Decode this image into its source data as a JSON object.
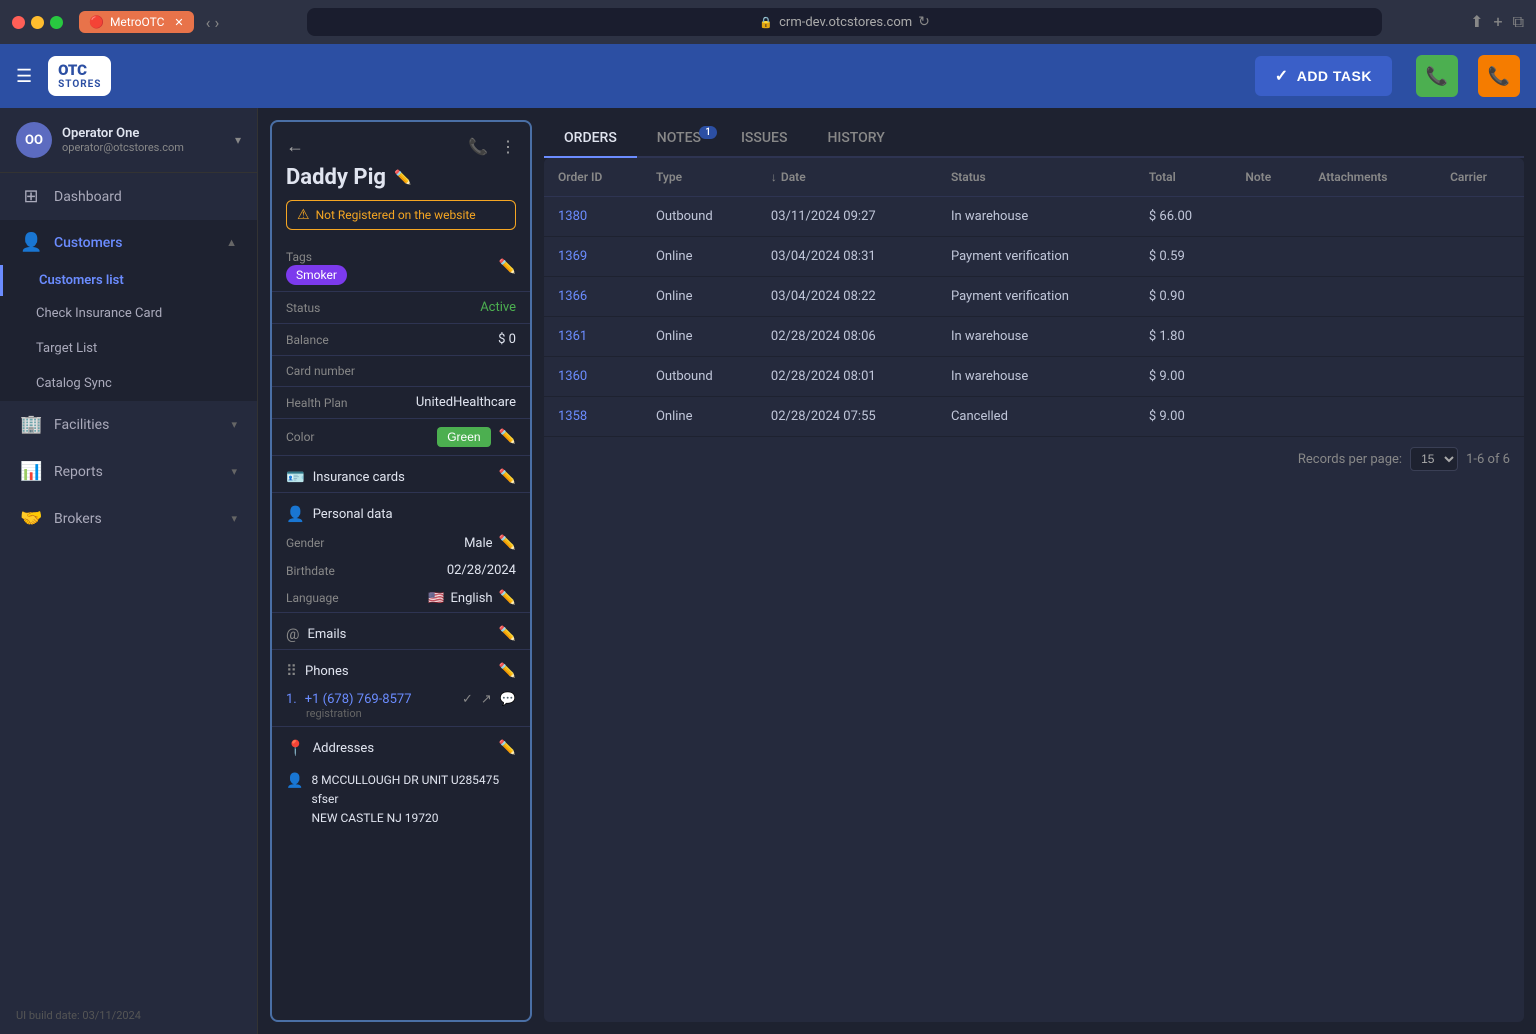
{
  "titlebar": {
    "tab_label": "MetroOTC",
    "url": "crm-dev.otcstores.com"
  },
  "header": {
    "logo_otc": "OTC",
    "logo_stores": "STORES",
    "add_task_label": "ADD TASK"
  },
  "sidebar": {
    "user": {
      "initials": "OO",
      "name": "Operator One",
      "email": "operator@otcstores.com"
    },
    "nav_items": [
      {
        "id": "dashboard",
        "label": "Dashboard",
        "icon": "⊞"
      },
      {
        "id": "customers",
        "label": "Customers",
        "icon": "👤",
        "active": true,
        "expanded": true
      },
      {
        "id": "facilities",
        "label": "Facilities",
        "icon": "🏢",
        "has_arrow": true
      },
      {
        "id": "reports",
        "label": "Reports",
        "icon": "📊",
        "has_arrow": true
      },
      {
        "id": "brokers",
        "label": "Brokers",
        "icon": "🤝",
        "has_arrow": true
      }
    ],
    "customers_sub": [
      {
        "id": "customers-list",
        "label": "Customers list",
        "active": true
      },
      {
        "id": "check-insurance",
        "label": "Check Insurance Card"
      },
      {
        "id": "target-list",
        "label": "Target List"
      },
      {
        "id": "catalog-sync",
        "label": "Catalog Sync"
      }
    ],
    "footer": "UI build date: 03/11/2024"
  },
  "customer": {
    "name": "Daddy Pig",
    "not_registered": "Not Registered on the website",
    "tags_label": "Tags",
    "tag": "Smoker",
    "status_label": "Status",
    "status_value": "Active",
    "balance_label": "Balance",
    "balance_value": "$ 0",
    "card_number_label": "Card number",
    "health_plan_label": "Health Plan",
    "health_plan_value": "UnitedHealthcare",
    "color_label": "Color",
    "color_value": "Green",
    "insurance_cards_label": "Insurance cards",
    "personal_data_label": "Personal data",
    "gender_label": "Gender",
    "gender_value": "Male",
    "birthdate_label": "Birthdate",
    "birthdate_value": "02/28/2024",
    "language_label": "Language",
    "language_flag": "🇺🇸",
    "language_value": "English",
    "emails_label": "Emails",
    "phones_label": "Phones",
    "phone_number": "+1 (678) 769-8577",
    "phone_sub": "registration",
    "addresses_label": "Addresses",
    "address_line1": "8 MCCULLOUGH DR UNIT U285475",
    "address_line2": "sfser",
    "address_line3": "NEW CASTLE NJ 19720"
  },
  "tabs": [
    {
      "id": "orders",
      "label": "ORDERS",
      "active": true,
      "badge": null
    },
    {
      "id": "notes",
      "label": "NOTES",
      "active": false,
      "badge": "1"
    },
    {
      "id": "issues",
      "label": "ISSUES",
      "active": false,
      "badge": null
    },
    {
      "id": "history",
      "label": "HISTORY",
      "active": false,
      "badge": null
    }
  ],
  "table": {
    "columns": [
      {
        "id": "order-id",
        "label": "Order ID"
      },
      {
        "id": "type",
        "label": "Type"
      },
      {
        "id": "date",
        "label": "Date",
        "sortable": true,
        "sort_dir": "desc"
      },
      {
        "id": "status",
        "label": "Status"
      },
      {
        "id": "total",
        "label": "Total"
      },
      {
        "id": "note",
        "label": "Note"
      },
      {
        "id": "attachments",
        "label": "Attachments"
      },
      {
        "id": "carrier",
        "label": "Carrier"
      }
    ],
    "rows": [
      {
        "order_id": "1380",
        "type": "Outbound",
        "date": "03/11/2024 09:27",
        "status": "In warehouse",
        "total": "$ 66.00"
      },
      {
        "order_id": "1369",
        "type": "Online",
        "date": "03/04/2024 08:31",
        "status": "Payment verification",
        "total": "$ 0.59"
      },
      {
        "order_id": "1366",
        "type": "Online",
        "date": "03/04/2024 08:22",
        "status": "Payment verification",
        "total": "$ 0.90"
      },
      {
        "order_id": "1361",
        "type": "Online",
        "date": "02/28/2024 08:06",
        "status": "In warehouse",
        "total": "$ 1.80"
      },
      {
        "order_id": "1360",
        "type": "Outbound",
        "date": "02/28/2024 08:01",
        "status": "In warehouse",
        "total": "$ 9.00"
      },
      {
        "order_id": "1358",
        "type": "Online",
        "date": "02/28/2024 07:55",
        "status": "Cancelled",
        "total": "$ 9.00"
      }
    ],
    "footer": {
      "records_per_page_label": "Records per page:",
      "per_page_value": "15",
      "pagination": "1-6 of 6"
    }
  }
}
